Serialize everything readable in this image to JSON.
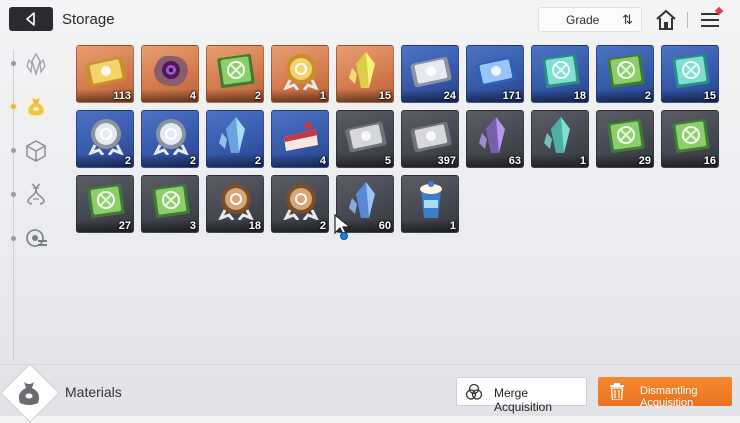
{
  "header": {
    "title": "Storage",
    "sort_label": "Grade"
  },
  "sidebar": {
    "tabs": [
      {
        "name": "crystal-tab-icon",
        "active": false
      },
      {
        "name": "materials-bag-tab-icon",
        "active": true
      },
      {
        "name": "cube-tab-icon",
        "active": false
      },
      {
        "name": "dna-tab-icon",
        "active": false
      },
      {
        "name": "module-tab-icon",
        "active": false
      }
    ]
  },
  "inventory": {
    "items": [
      {
        "icon": "gold-ticket-icon",
        "rarity": "orange",
        "qty": "113"
      },
      {
        "icon": "purple-eye-core-icon",
        "rarity": "orange",
        "qty": "4"
      },
      {
        "icon": "sword-manual-icon",
        "rarity": "orange",
        "qty": "2"
      },
      {
        "icon": "gold-shield-emblem-icon",
        "rarity": "orange",
        "qty": "1"
      },
      {
        "icon": "yellow-crystal-shards-icon",
        "rarity": "orange",
        "qty": "15"
      },
      {
        "icon": "silver-ticket-icon",
        "rarity": "blue",
        "qty": "24"
      },
      {
        "icon": "compass-ticket-icon",
        "rarity": "blue",
        "qty": "171"
      },
      {
        "icon": "shield-manual-icon",
        "rarity": "blue",
        "qty": "18"
      },
      {
        "icon": "cross-manual-icon",
        "rarity": "blue",
        "qty": "2"
      },
      {
        "icon": "rune-manual-icon",
        "rarity": "blue",
        "qty": "15"
      },
      {
        "icon": "silver-sword-emblem-icon",
        "rarity": "blue",
        "qty": "2"
      },
      {
        "icon": "silver-rune-emblem-icon",
        "rarity": "blue",
        "qty": "2"
      },
      {
        "icon": "ice-crystal-icon",
        "rarity": "blue",
        "qty": "2"
      },
      {
        "icon": "cake-slice-icon",
        "rarity": "blue",
        "qty": "4"
      },
      {
        "icon": "gray-ticket-icon",
        "rarity": "dark",
        "qty": "5"
      },
      {
        "icon": "gray-compass-ticket-icon",
        "rarity": "dark",
        "qty": "397"
      },
      {
        "icon": "violet-crystal-icon",
        "rarity": "dark",
        "qty": "63"
      },
      {
        "icon": "teal-crystal-icon",
        "rarity": "dark",
        "qty": "1"
      },
      {
        "icon": "green-sword-manual-icon",
        "rarity": "dark",
        "qty": "29"
      },
      {
        "icon": "green-shield-manual-icon",
        "rarity": "dark",
        "qty": "16"
      },
      {
        "icon": "green-cross-manual-icon",
        "rarity": "dark",
        "qty": "27"
      },
      {
        "icon": "green-rune-manual-icon",
        "rarity": "dark",
        "qty": "3"
      },
      {
        "icon": "bronze-sword-emblem-icon",
        "rarity": "dark",
        "qty": "18"
      },
      {
        "icon": "bronze-rune-emblem-icon",
        "rarity": "dark",
        "qty": "2"
      },
      {
        "icon": "blue-crystal-cluster-icon",
        "rarity": "dark",
        "qty": "60"
      },
      {
        "icon": "iced-coffee-icon",
        "rarity": "dark",
        "qty": "1"
      }
    ]
  },
  "footer": {
    "category_label": "Materials",
    "merge_label": "Merge Acquisition",
    "dismantle_label": "Dismantling Acquisition"
  },
  "colors": {
    "orange_slot": "#d2794b",
    "blue_slot": "#3558a8",
    "dark_slot": "#44474f",
    "accent": "#ec7120"
  }
}
